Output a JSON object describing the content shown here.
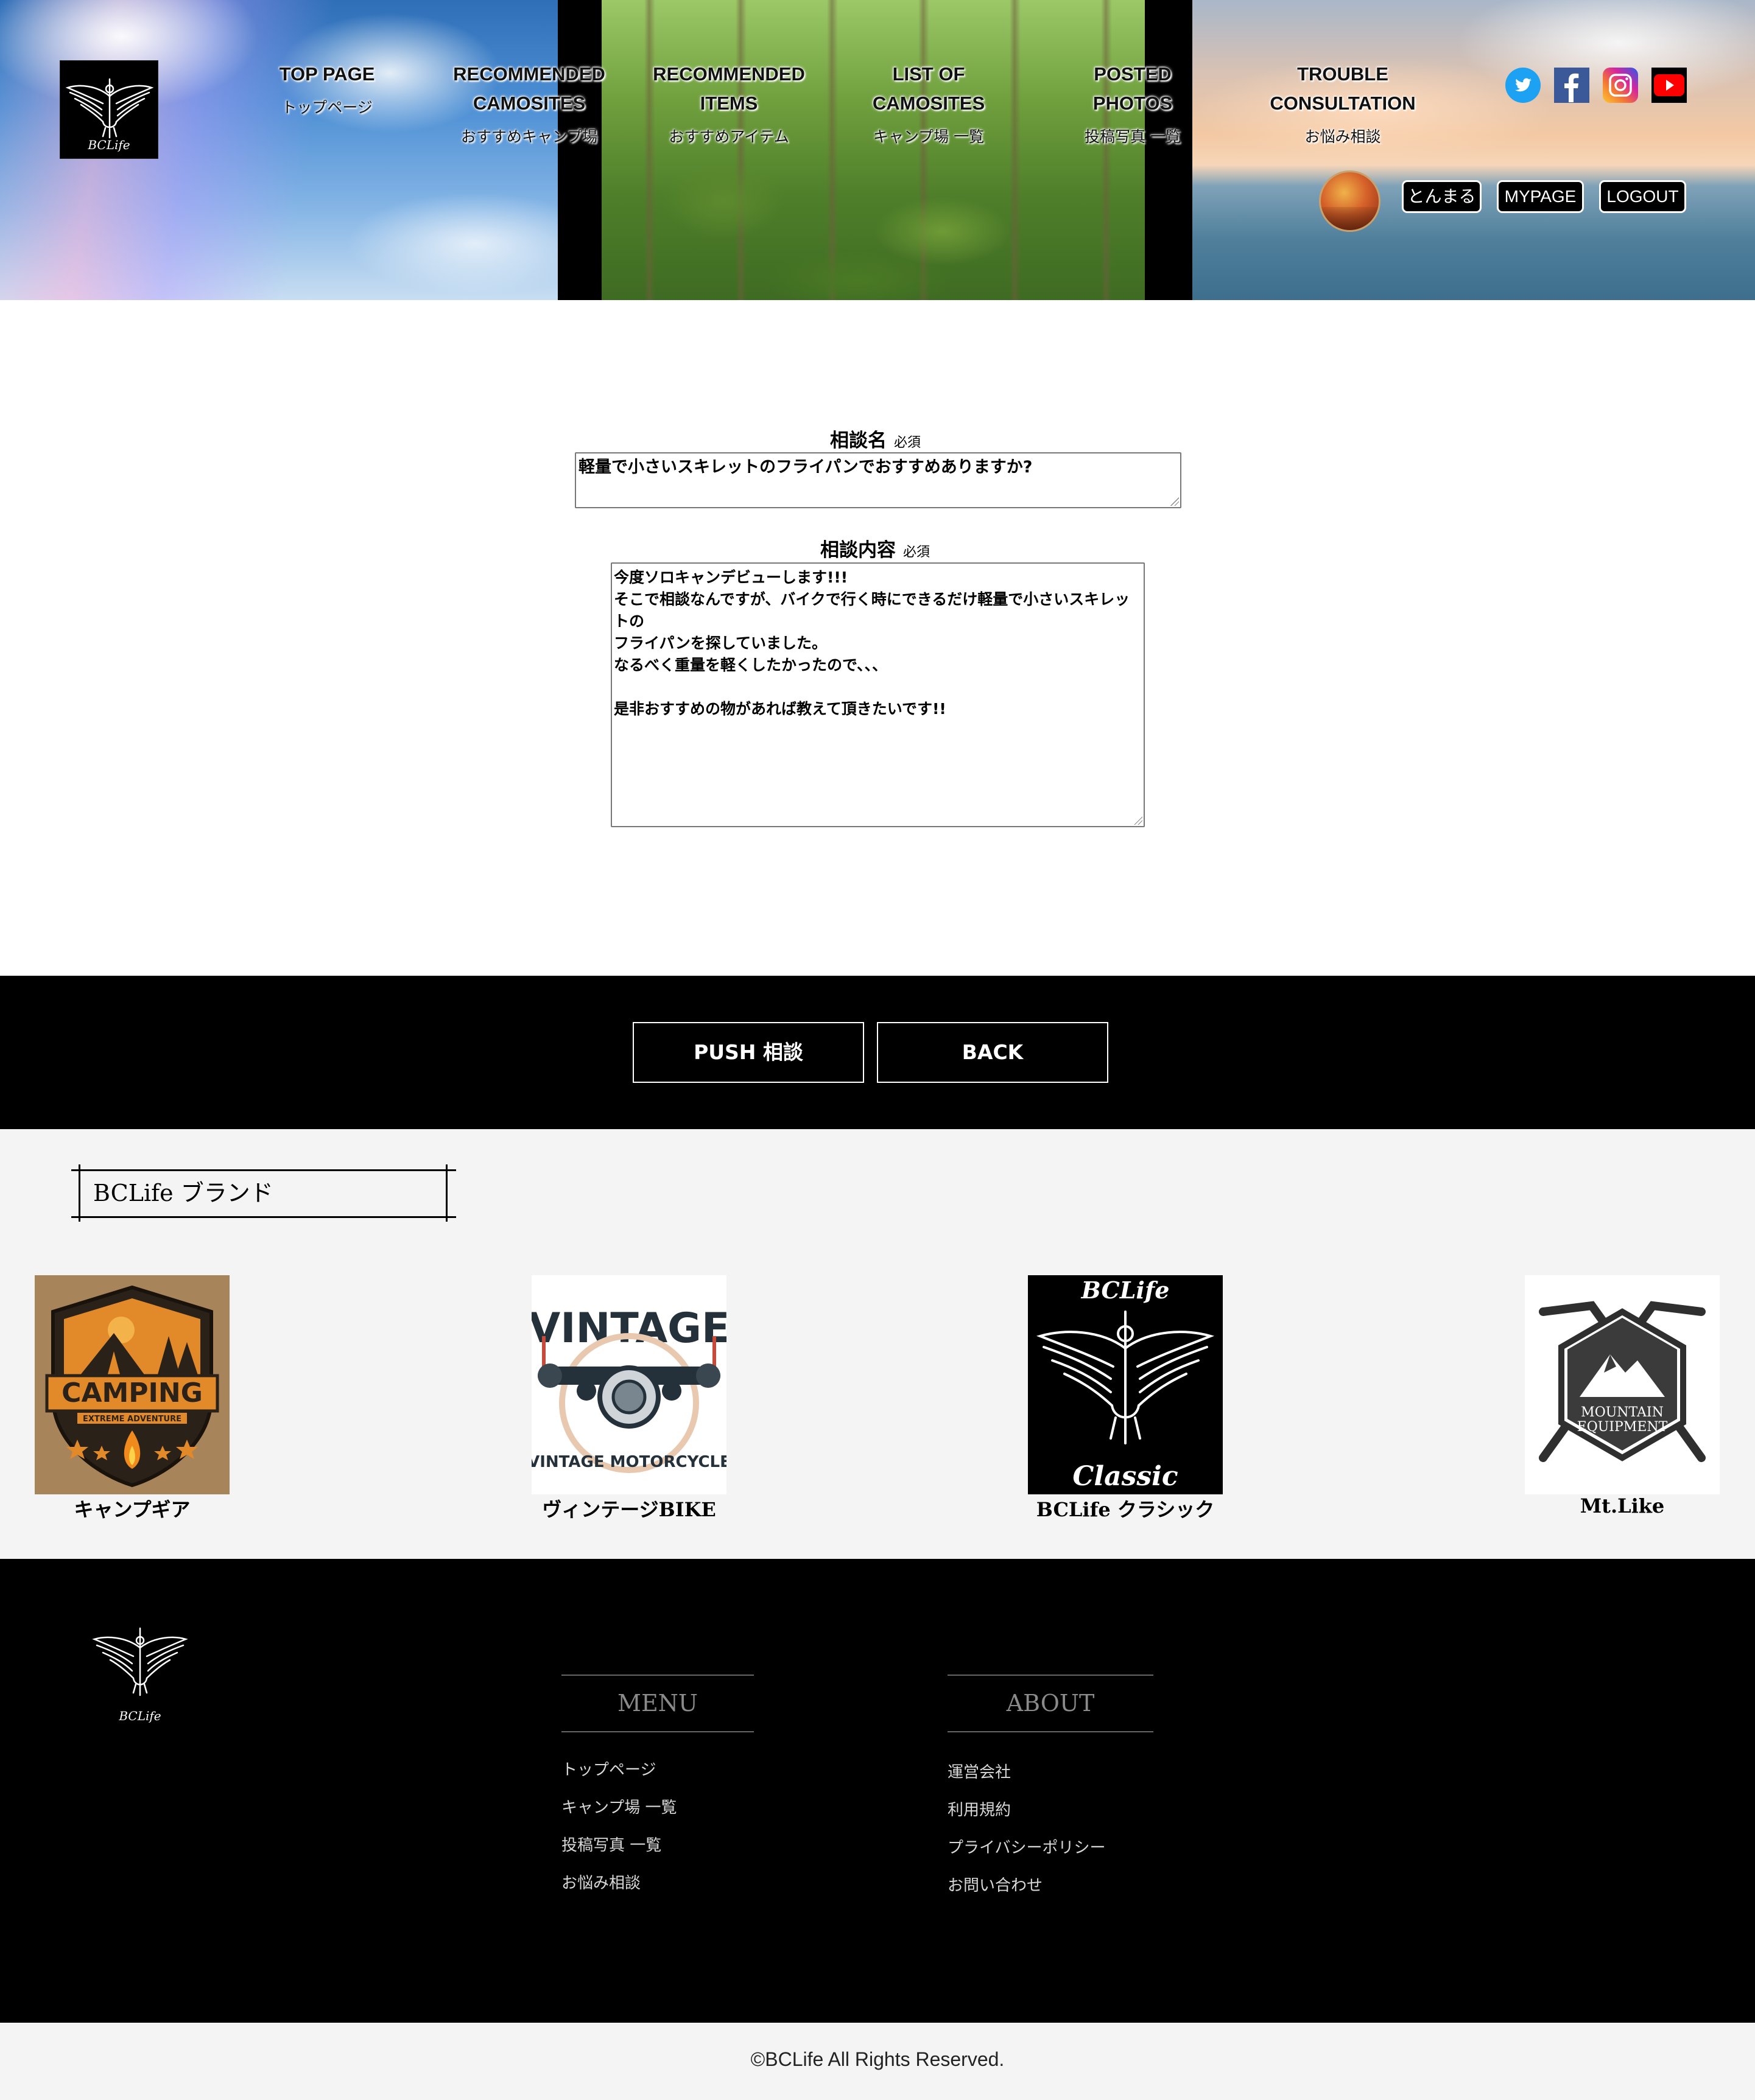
{
  "brand_logo_text": "BCLife",
  "nav": [
    {
      "en": "TOP PAGE",
      "ja": "トップページ"
    },
    {
      "en": "RECOMMENDED CAMOSITES",
      "ja": "おすすめキャンプ場"
    },
    {
      "en": "RECOMMENDED ITEMS",
      "ja": "おすすめアイテム"
    },
    {
      "en": "LIST OF CAMOSITES",
      "ja": "キャンプ場 一覧"
    },
    {
      "en": "POSTED PHOTOS",
      "ja": "投稿写真 一覧"
    },
    {
      "en": "TROUBLE CONSULTATION",
      "ja": "お悩み相談"
    }
  ],
  "social": [
    {
      "icon": "twitter-icon",
      "color": "#1da1f2"
    },
    {
      "icon": "facebook-icon",
      "color": "#3b5998"
    },
    {
      "icon": "instagram-icon",
      "color": "#d6249f"
    },
    {
      "icon": "youtube-icon",
      "color": "#ff0000"
    }
  ],
  "user": {
    "name": "とんまる",
    "mypage_label": "MYPAGE",
    "logout_label": "LOGOUT"
  },
  "form": {
    "title_label": "相談名",
    "title_required": "必須",
    "title_value": "軽量で小さいスキレットのフライパンでおすすめありますか?",
    "body_label": "相談内容",
    "body_required": "必須",
    "body_value": "今度ソロキャンデビューします!!!\nそこで相談なんですが、バイクで行く時にできるだけ軽量で小さいスキレットの\nフライパンを探していました。\nなるべく重量を軽くしたかったので、、、\n\n是非おすすめの物があれば教えて頂きたいです!!"
  },
  "actions": {
    "push_label": "PUSH 相談",
    "back_label": "BACK"
  },
  "brand_section": {
    "title": "BCLife ブランド",
    "items": [
      {
        "name": "キャンプギア",
        "logo_text": "CAMPING",
        "logo_sub": "EXTREME ADVENTURE"
      },
      {
        "name": "ヴィンテージBIKE",
        "logo_text": "VINTAGE",
        "logo_sub": "VINTAGE MOTORCYCLE"
      },
      {
        "name": "BCLife クラシック",
        "logo_text": "BCLife",
        "logo_sub": "Classic"
      },
      {
        "name": "Mt.Like",
        "logo_text": "MOUNTAIN",
        "logo_sub": "EQUIPMENT"
      }
    ]
  },
  "footer": {
    "logo_text": "BCLife",
    "menu_title": "MENU",
    "menu_links": [
      "トップページ",
      "キャンプ場 一覧",
      "投稿写真 一覧",
      "お悩み相談"
    ],
    "about_title": "ABOUT",
    "about_links": [
      "運営会社",
      "利用規約",
      "プライバシーポリシー",
      "お問い合わせ"
    ],
    "copyright": "©BCLife All Rights Reserved."
  }
}
